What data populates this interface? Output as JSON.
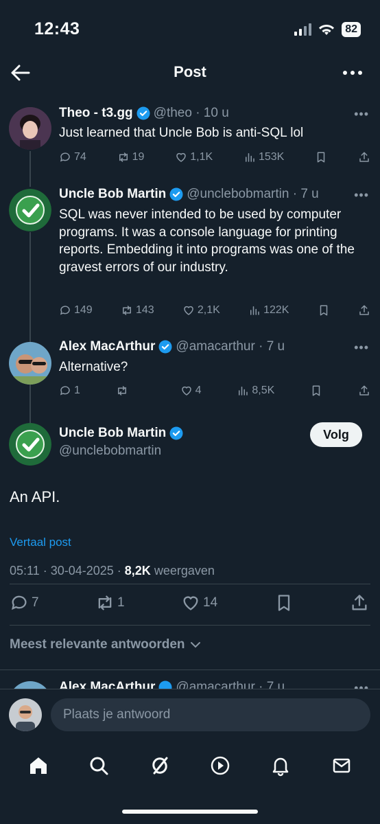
{
  "status": {
    "time": "12:43",
    "battery": "82"
  },
  "header": {
    "title": "Post"
  },
  "thread": [
    {
      "name": "Theo - t3.gg",
      "handle": "@theo · 10 u",
      "text": "Just learned that Uncle Bob is anti-SQL lol",
      "replies": "74",
      "reposts": "19",
      "likes": "1,1K",
      "views": "153K"
    },
    {
      "name": "Uncle Bob Martin",
      "handle": "@unclebobmartin · 7 u",
      "text": "SQL was never intended to be used by computer programs. It was a console language for printing reports. Embedding it into programs was one of the gravest errors of our industry.",
      "replies": "149",
      "reposts": "143",
      "likes": "2,1K",
      "views": "122K"
    },
    {
      "name": "Alex MacArthur",
      "handle": "@amacarthur · 7 u",
      "text": "Alternative?",
      "replies": "1",
      "reposts": "",
      "likes": "4",
      "views": "8,5K"
    }
  ],
  "main_post": {
    "name": "Uncle Bob Martin",
    "handle": "@unclebobmartin",
    "follow_label": "Volg",
    "text": "An API.",
    "translate": "Vertaal post",
    "timestamp": "05:11 · 30-04-2025 · ",
    "views_count": "8,2K",
    "views_label": " weergaven",
    "replies": "7",
    "reposts": "1",
    "likes": "14"
  },
  "relevant_label": "Meest relevante antwoorden",
  "next_reply": {
    "name": "Alex MacArthur",
    "handle": "@amacarthur · 7 u"
  },
  "reply_input": {
    "placeholder": "Plaats je antwoord"
  },
  "colors": {
    "background": "#15202b",
    "accent": "#1d9bf0",
    "muted": "#8b98a5",
    "verified": "#1d9bf0"
  }
}
